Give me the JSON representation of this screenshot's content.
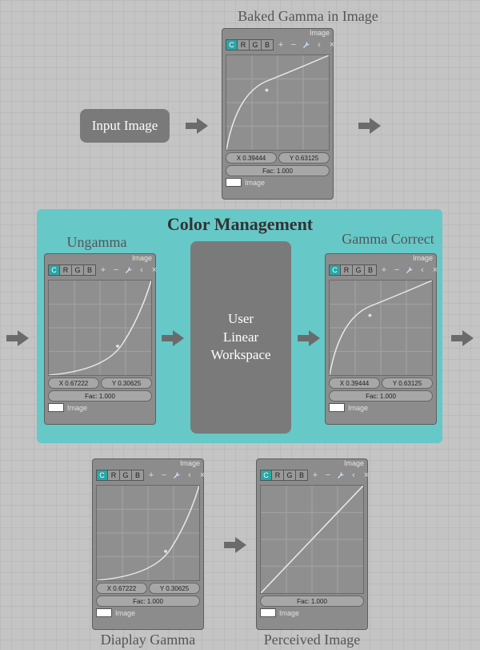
{
  "labels": {
    "bakedGamma": "Baked Gamma in Image",
    "inputImage": "Input Image",
    "colorManagement": "Color Management",
    "ungamma": "Ungamma",
    "gammaCorrect": "Gamma Correct",
    "userLinearWorkspace": "User\nLinear\nWorkspace",
    "displayGamma": "Diaplay Gamma",
    "perceivedImage": "Perceived Image"
  },
  "nodeCommon": {
    "title": "Image",
    "tabs": [
      "C",
      "R",
      "G",
      "B"
    ],
    "facLabel": "Fac: 1.000",
    "bottomLabel": "Image"
  },
  "nodes": {
    "baked": {
      "x": "X 0.39444",
      "y": "Y 0.63125",
      "showXY": true,
      "curve": "concaveDown"
    },
    "ungamma": {
      "x": "X 0.67222",
      "y": "Y 0.30625",
      "showXY": true,
      "curve": "concaveUp"
    },
    "gammaC": {
      "x": "X 0.39444",
      "y": "Y 0.63125",
      "showXY": true,
      "curve": "concaveDown"
    },
    "display": {
      "x": "X 0.67222",
      "y": "Y 0.30625",
      "showXY": true,
      "curve": "concaveUp"
    },
    "perceived": {
      "x": "",
      "y": "",
      "showXY": false,
      "curve": "linear"
    }
  },
  "chart_data": [
    {
      "type": "line",
      "title": "Baked Gamma in Image",
      "xlabel": "",
      "ylabel": "",
      "xlim": [
        0,
        1
      ],
      "ylim": [
        0,
        1
      ],
      "x": [
        0,
        0.1,
        0.2,
        0.3,
        0.394,
        0.5,
        0.6,
        0.7,
        0.8,
        0.9,
        1.0
      ],
      "values": [
        0,
        0.28,
        0.43,
        0.54,
        0.631,
        0.72,
        0.79,
        0.85,
        0.91,
        0.96,
        1.0
      ],
      "annotations": [
        "X 0.39444",
        "Y 0.63125",
        "Fac: 1.000"
      ]
    },
    {
      "type": "line",
      "title": "Ungamma",
      "xlabel": "",
      "ylabel": "",
      "xlim": [
        0,
        1
      ],
      "ylim": [
        0,
        1
      ],
      "x": [
        0,
        0.1,
        0.2,
        0.3,
        0.4,
        0.5,
        0.6,
        0.672,
        0.8,
        0.9,
        1.0
      ],
      "values": [
        0,
        0.01,
        0.04,
        0.08,
        0.14,
        0.22,
        0.29,
        0.306,
        0.53,
        0.73,
        1.0
      ],
      "annotations": [
        "X 0.67222",
        "Y 0.30625",
        "Fac: 1.000"
      ]
    },
    {
      "type": "line",
      "title": "Gamma Correct",
      "xlabel": "",
      "ylabel": "",
      "xlim": [
        0,
        1
      ],
      "ylim": [
        0,
        1
      ],
      "x": [
        0,
        0.1,
        0.2,
        0.3,
        0.394,
        0.5,
        0.6,
        0.7,
        0.8,
        0.9,
        1.0
      ],
      "values": [
        0,
        0.28,
        0.43,
        0.54,
        0.631,
        0.72,
        0.79,
        0.85,
        0.91,
        0.96,
        1.0
      ],
      "annotations": [
        "X 0.39444",
        "Y 0.63125",
        "Fac: 1.000"
      ]
    },
    {
      "type": "line",
      "title": "Diaplay Gamma",
      "xlabel": "",
      "ylabel": "",
      "xlim": [
        0,
        1
      ],
      "ylim": [
        0,
        1
      ],
      "x": [
        0,
        0.1,
        0.2,
        0.3,
        0.4,
        0.5,
        0.6,
        0.672,
        0.8,
        0.9,
        1.0
      ],
      "values": [
        0,
        0.01,
        0.04,
        0.08,
        0.14,
        0.22,
        0.29,
        0.306,
        0.53,
        0.73,
        1.0
      ],
      "annotations": [
        "X 0.67222",
        "Y 0.30625",
        "Fac: 1.000"
      ]
    },
    {
      "type": "line",
      "title": "Perceived Image",
      "xlabel": "",
      "ylabel": "",
      "xlim": [
        0,
        1
      ],
      "ylim": [
        0,
        1
      ],
      "x": [
        0,
        0.25,
        0.5,
        0.75,
        1.0
      ],
      "values": [
        0,
        0.25,
        0.5,
        0.75,
        1.0
      ],
      "annotations": [
        "Fac: 1.000"
      ]
    }
  ]
}
